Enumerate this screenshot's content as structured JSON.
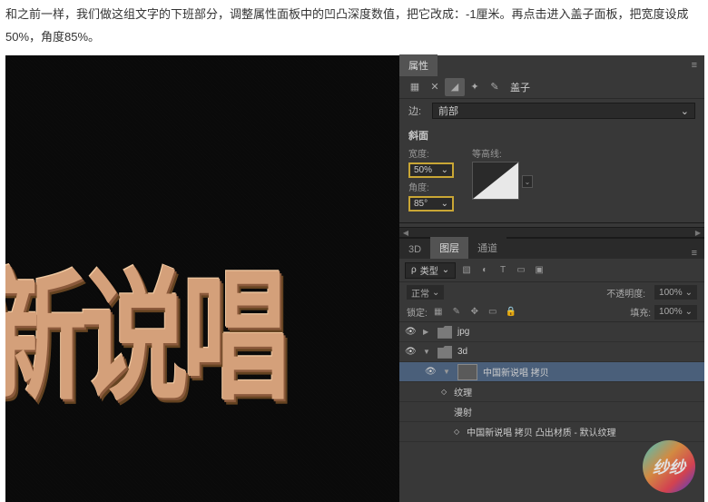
{
  "instruction": "和之前一样，我们做这组文字的下班部分，调整属性面板中的凹凸深度数值，把它改成：-1厘米。再点击进入盖子面板，把宽度设成50%，角度85%。",
  "canvas_text": "新说唱",
  "props": {
    "panel_title": "属性",
    "cap_label": "盖子",
    "side_label": "边:",
    "side_value": "前部",
    "bevel_title": "斜面",
    "width_label": "宽度:",
    "width_value": "50%",
    "angle_label": "角度:",
    "angle_value": "85°",
    "contour_label": "等高线:"
  },
  "layers": {
    "tab_3d": "3D",
    "tab_layers": "图层",
    "tab_channels": "通道",
    "type_label": "类型",
    "blend_mode": "正常",
    "opacity_label": "不透明度:",
    "opacity_value": "100%",
    "lock_label": "锁定:",
    "fill_label": "填充:",
    "fill_value": "100%",
    "items": [
      {
        "name": "jpg",
        "type": "folder"
      },
      {
        "name": "3d",
        "type": "folder"
      },
      {
        "name": "中国新说唱 拷贝",
        "type": "layer",
        "selected": true
      },
      {
        "name": "纹理",
        "type": "sub"
      },
      {
        "name": "漫射",
        "type": "sub2"
      },
      {
        "name": "中国新说唱 拷贝 凸出材质 - 默认纹理",
        "type": "sub3"
      }
    ]
  }
}
